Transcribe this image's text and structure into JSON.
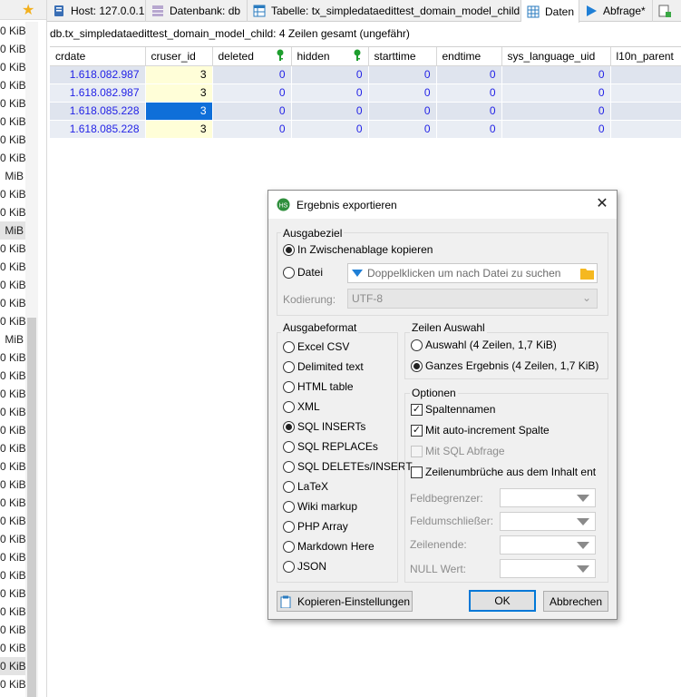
{
  "sidebar": {
    "sizes": [
      "0 KiB",
      "0 KiB",
      "0 KiB",
      "0 KiB",
      "0 KiB",
      "0 KiB",
      "0 KiB",
      "0 KiB",
      "MiB",
      "0 KiB",
      "0 KiB",
      "MiB",
      "0 KiB",
      "0 KiB",
      "0 KiB",
      "0 KiB",
      "0 KiB",
      "MiB",
      "0 KiB",
      "0 KiB",
      "0 KiB",
      "0 KiB",
      "0 KiB",
      "0 KiB",
      "0 KiB",
      "0 KiB",
      "0 KiB",
      "0 KiB",
      "0 KiB",
      "0 KiB",
      "0 KiB",
      "0 KiB",
      "0 KiB",
      "0 KiB",
      "0 KiB",
      "0 KiB",
      "0 KiB"
    ]
  },
  "tabs": [
    {
      "label": "Host: 127.0.0.1",
      "icon": "host-icon"
    },
    {
      "label": "Datenbank: db",
      "icon": "database-icon"
    },
    {
      "label": "Tabelle: tx_simpledataedittest_domain_model_child",
      "icon": "table-icon"
    },
    {
      "label": "Daten",
      "icon": "grid-icon"
    },
    {
      "label": "Abfrage*",
      "icon": "play-icon"
    }
  ],
  "table_caption": "db.tx_simpledataedittest_domain_model_child: 4 Zeilen gesamt (ungefähr)",
  "grid": {
    "columns": [
      "crdate",
      "cruser_id",
      "deleted",
      "hidden",
      "starttime",
      "endtime",
      "sys_language_uid",
      "l10n_parent"
    ],
    "key_columns": [
      "deleted",
      "hidden"
    ],
    "rows": [
      [
        "1.618.082.987",
        "3",
        "0",
        "0",
        "0",
        "0",
        "0",
        ""
      ],
      [
        "1.618.082.987",
        "3",
        "0",
        "0",
        "0",
        "0",
        "0",
        ""
      ],
      [
        "1.618.085.228",
        "3",
        "0",
        "0",
        "0",
        "0",
        "0",
        ""
      ],
      [
        "1.618.085.228",
        "3",
        "0",
        "0",
        "0",
        "0",
        "0",
        ""
      ]
    ]
  },
  "dialog": {
    "title": "Ergebnis exportieren",
    "ausgabeziel": {
      "label": "Ausgabeziel",
      "option_clipboard": "In Zwischenablage kopieren",
      "option_file": "Datei",
      "file_placeholder": "Doppelklicken um nach Datei zu suchen",
      "encoding_label": "Kodierung:",
      "encoding_value": "UTF-8",
      "selected": "clipboard"
    },
    "ausgabeformat": {
      "label": "Ausgabeformat",
      "options": [
        "Excel CSV",
        "Delimited text",
        "HTML table",
        "XML",
        "SQL INSERTs",
        "SQL REPLACEs",
        "SQL DELETEs/INSERT",
        "LaTeX",
        "Wiki markup",
        "PHP Array",
        "Markdown Here",
        "JSON"
      ],
      "selected": "SQL INSERTs"
    },
    "zeilen_auswahl": {
      "label": "Zeilen Auswahl",
      "option_selection": "Auswahl (4 Zeilen, 1,7 KiB)",
      "option_all": "Ganzes Ergebnis (4 Zeilen, 1,7 KiB)",
      "selected": "all"
    },
    "optionen": {
      "label": "Optionen",
      "checkboxes": [
        {
          "label": "Spaltennamen",
          "checked": true,
          "enabled": true
        },
        {
          "label": "Mit auto-increment Spalte",
          "checked": true,
          "enabled": true
        },
        {
          "label": "Mit SQL Abfrage",
          "checked": false,
          "enabled": false
        },
        {
          "label": "Zeilenumbrüche aus dem Inhalt ent",
          "checked": false,
          "enabled": true
        }
      ],
      "fields": [
        "Feldbegrenzer:",
        "Feldumschließer:",
        "Zeilenende:",
        "NULL Wert:"
      ]
    },
    "buttons": {
      "copy_settings": "Kopieren-Einstellungen",
      "ok": "OK",
      "cancel": "Abbrechen"
    }
  },
  "colors": {
    "selection_blue": "#0f6fd9",
    "number_blue": "#2323e6",
    "key_green": "#1e9e2e",
    "accent_blue": "#0078d7",
    "star_yellow": "#f2b01e"
  }
}
